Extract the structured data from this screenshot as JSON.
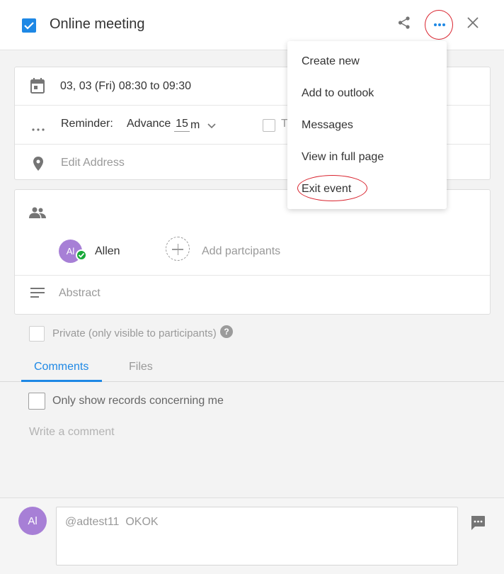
{
  "header": {
    "title": "Online meeting",
    "icons": {
      "checkbox": "checkbox-checked-icon",
      "share": "share-icon",
      "more": "more-horizontal-icon",
      "close": "close-icon"
    },
    "accent_color": "#1e88e5",
    "highlight_color": "#d9232e"
  },
  "event": {
    "datetime": "03, 03 (Fri) 08:30 to 09:30",
    "reminder_label": "Reminder:",
    "reminder_mode": "Advance",
    "reminder_value": "15",
    "reminder_unit": "m",
    "partial_checkbox_label": "T",
    "address_placeholder": "Edit Address"
  },
  "participants": {
    "list": [
      {
        "initials": "Al",
        "name": "Allen",
        "status": "accepted"
      }
    ],
    "add_label": "Add partcipants"
  },
  "abstract_placeholder": "Abstract",
  "private_label": "Private (only visible to participants)",
  "help_glyph": "?",
  "tabs": [
    {
      "label": "Comments",
      "active": true
    },
    {
      "label": "Files",
      "active": false
    }
  ],
  "filter_label": "Only show records concerning me",
  "comment_placeholder": "Write a comment",
  "composer": {
    "avatar_initials": "Al",
    "value": "@adtest11  OKOK"
  },
  "menu": {
    "items": [
      "Create new",
      "Add to outlook",
      "Messages",
      "View in full page",
      "Exit event"
    ]
  }
}
